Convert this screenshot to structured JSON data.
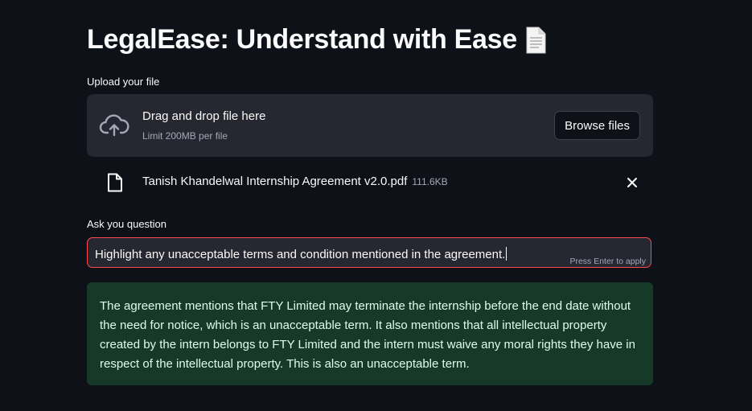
{
  "page": {
    "title": "LegalEase: Understand with Ease",
    "title_icon": "page-facing-up-icon"
  },
  "uploader": {
    "label": "Upload your file",
    "drop_text": "Drag and drop file here",
    "limit_text": "Limit 200MB per file",
    "browse_label": "Browse files",
    "icon": "cloud-upload-icon"
  },
  "uploaded_file": {
    "name": "Tanish Khandelwal Internship Agreement v2.0.pdf",
    "size": "111.6KB",
    "icon": "file-icon",
    "remove_icon": "close-icon"
  },
  "question": {
    "label": "Ask you question",
    "value": "Highlight any unacceptable terms and condition mentioned in the agreement.",
    "hint": "Press Enter to apply"
  },
  "answer": {
    "text": "The agreement mentions that FTY Limited may terminate the internship before the end date without the need for notice, which is an unacceptable term. It also mentions that all intellectual property created by the intern belongs to FTY Limited and the intern must waive any moral rights they have in respect of the intellectual property. This is also an unacceptable term."
  },
  "colors": {
    "background": "#0e1117",
    "widget_background": "#262730",
    "focus_border": "#ff4b4b",
    "success_background": "#173928",
    "success_text": "#dffde9"
  }
}
